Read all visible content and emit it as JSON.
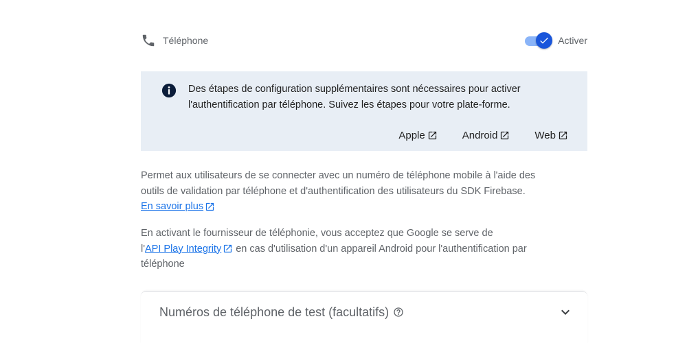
{
  "provider": {
    "label": "Téléphone",
    "icon": "phone-icon"
  },
  "toggle": {
    "label": "Activer",
    "enabled": true,
    "accent": "#1a56db"
  },
  "banner": {
    "icon": "info-icon",
    "line1": "Des étapes de configuration supplémentaires sont nécessaires pour activer",
    "line2": "l'authentification par téléphone. Suivez les étapes pour votre plate-forme.",
    "links": [
      {
        "label": "Apple",
        "icon": "external-link-icon"
      },
      {
        "label": "Android",
        "icon": "external-link-icon"
      },
      {
        "label": "Web",
        "icon": "external-link-icon"
      }
    ],
    "background": "#e8eef5"
  },
  "description": {
    "para1_line1": "Permet aux utilisateurs de se connecter avec un numéro de téléphone mobile à l'aide des",
    "para1_line2": "outils de validation par téléphone et d'authentification des utilisateurs du SDK Firebase.",
    "learn_more": "En savoir plus",
    "para2_line1": "En activant le fournisseur de téléphonie, vous acceptez que Google se serve de",
    "para2_prefix": "l'",
    "api_link": "API Play Integrity",
    "para2_suffix": " en cas d'utilisation d'un appareil Android pour l'authentification par",
    "para2_line3": "téléphone",
    "link_color": "#1a73e8"
  },
  "accordion": {
    "title": "Numéros de téléphone de test (facultatifs)",
    "help_icon": "help-icon",
    "chevron_icon": "chevron-down-icon"
  }
}
